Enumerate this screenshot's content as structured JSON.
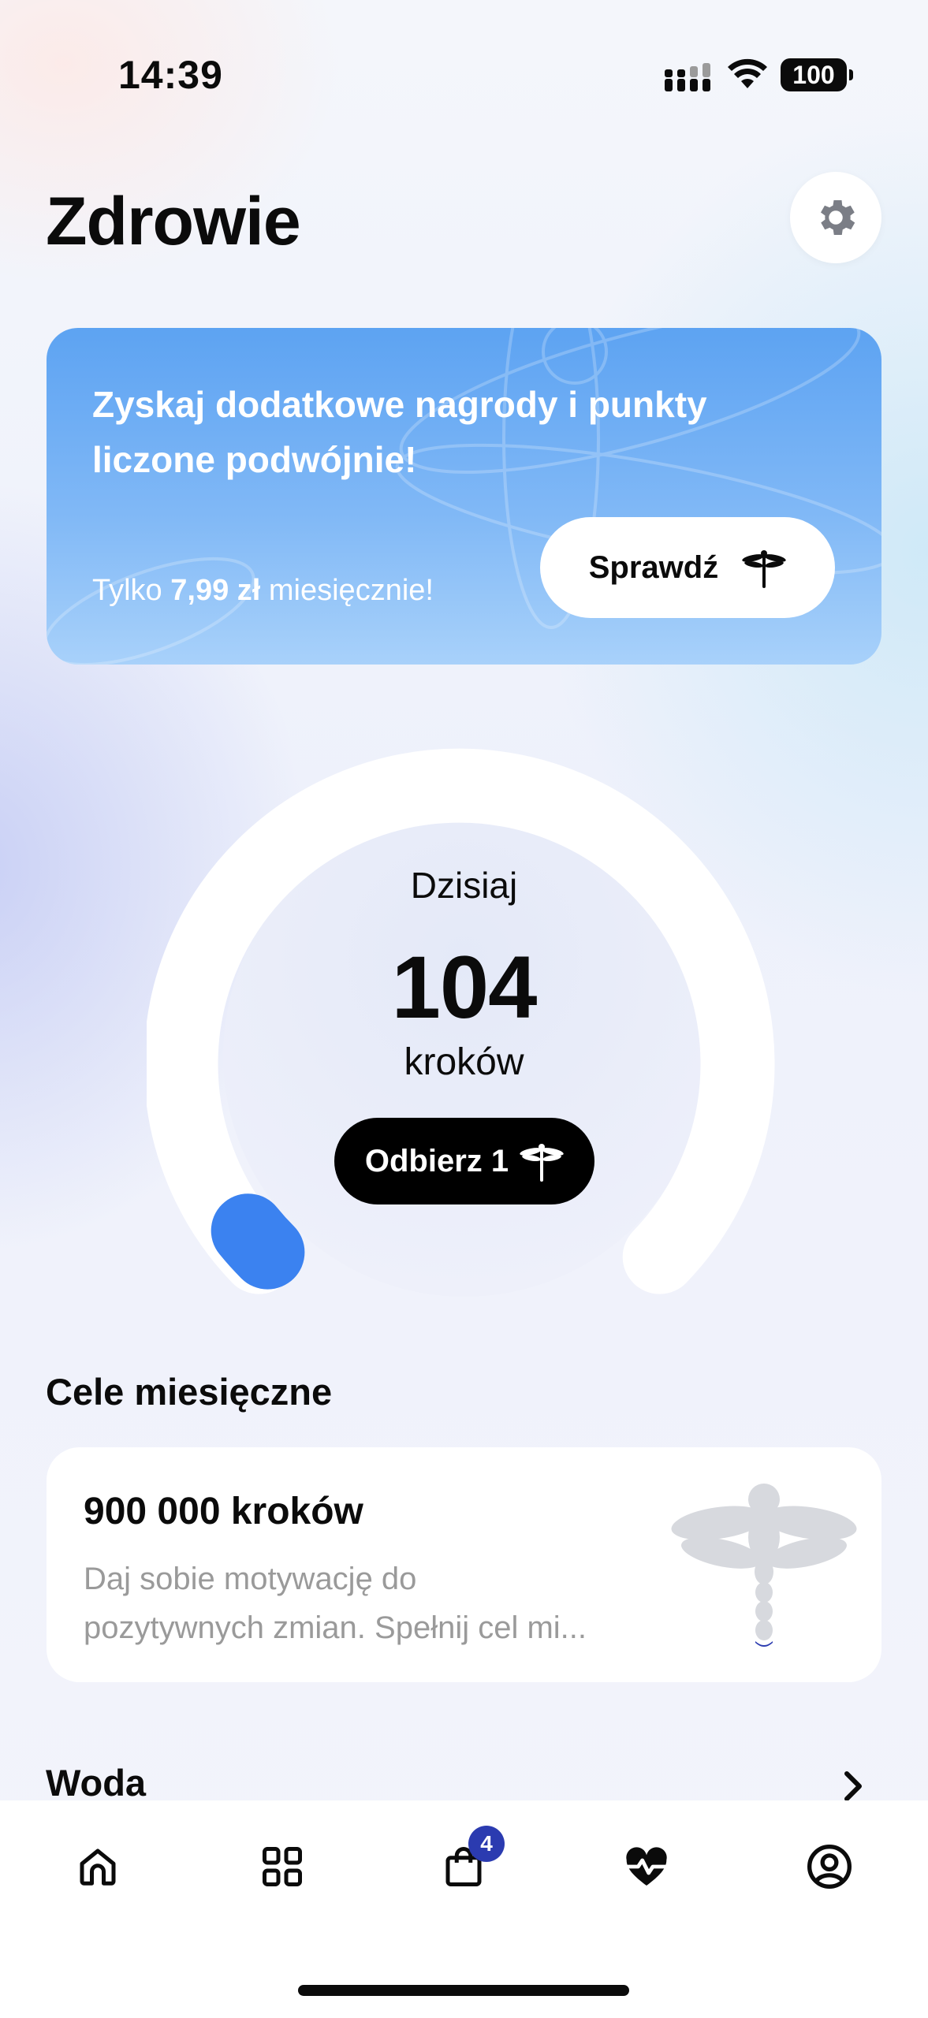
{
  "status": {
    "time": "14:39",
    "battery": "100"
  },
  "header": {
    "title": "Zdrowie"
  },
  "promo": {
    "title": "Zyskaj dodatkowe nagrody i punkty liczone podwójnie!",
    "price_prefix": "Tylko ",
    "price_value": "7,99 zł",
    "price_suffix": " miesięcznie!",
    "button_label": "Sprawdź"
  },
  "today": {
    "label": "Dzisiaj",
    "steps": "104",
    "unit": "kroków",
    "claim_label": "Odbierz 1",
    "progress": 0.01
  },
  "monthly_goals": {
    "section_title": "Cele miesięczne",
    "card_title": "900 000 kroków",
    "card_desc_line1": "Daj sobie motywację do",
    "card_desc_line2": "pozytywnych zmian. Spełnij cel mi..."
  },
  "water": {
    "title": "Woda"
  },
  "tabbar": {
    "cart_badge": "4",
    "tabs": [
      "home-icon",
      "grid-icon",
      "shopping-bag-icon",
      "heart-pulse-icon",
      "profile-icon"
    ],
    "active_color": "#0b0b0b"
  },
  "colors": {
    "accent": "#3b82f0",
    "promo": "#6aaaf4",
    "badge": "#2b3bb0"
  }
}
